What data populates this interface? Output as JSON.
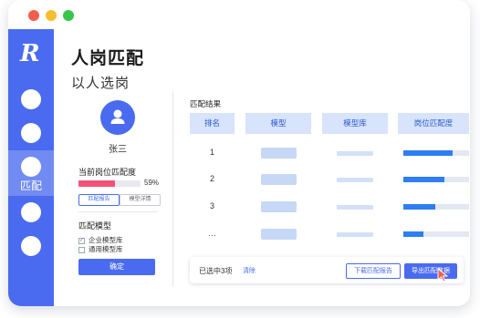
{
  "window": {
    "controls": [
      "close",
      "minimize",
      "maximize"
    ]
  },
  "sidebar": {
    "logo": "R",
    "active_item_label": "匹配",
    "items": [
      {
        "icon": "circle-icon"
      },
      {
        "icon": "circle-icon"
      },
      {
        "icon": "circle-icon",
        "label": "匹配",
        "active": true
      },
      {
        "icon": "circle-icon"
      },
      {
        "icon": "circle-icon"
      }
    ]
  },
  "header": {
    "title": "人岗匹配",
    "subtitle": "以人选岗"
  },
  "profile": {
    "name": "张三",
    "match_label": "当前岗位匹配度",
    "match_percent": 59,
    "match_percent_text": "59%",
    "btn_report": "匹配报告",
    "btn_detail": "模型详情"
  },
  "model_section": {
    "title": "匹配模型",
    "options": [
      {
        "label": "企业模型库",
        "checked": true
      },
      {
        "label": "通用模型库",
        "checked": false
      }
    ],
    "confirm_label": "确定"
  },
  "results": {
    "title": "匹配结果",
    "columns": [
      "排名",
      "模型",
      "模型库",
      "岗位匹配度"
    ],
    "rows": [
      {
        "rank": "1",
        "match": 0.75
      },
      {
        "rank": "2",
        "match": 0.62
      },
      {
        "rank": "3",
        "match": 0.48
      },
      {
        "rank": "…",
        "match": 0.3
      }
    ]
  },
  "footer": {
    "selected_text": "已选中3项",
    "clear_label": "清除",
    "download_label": "下载匹配报告",
    "export_label": "导出匹配数据"
  },
  "colors": {
    "accent": "#4a6bf0",
    "progress": "#f2527a",
    "bar": "#2f7df2"
  }
}
